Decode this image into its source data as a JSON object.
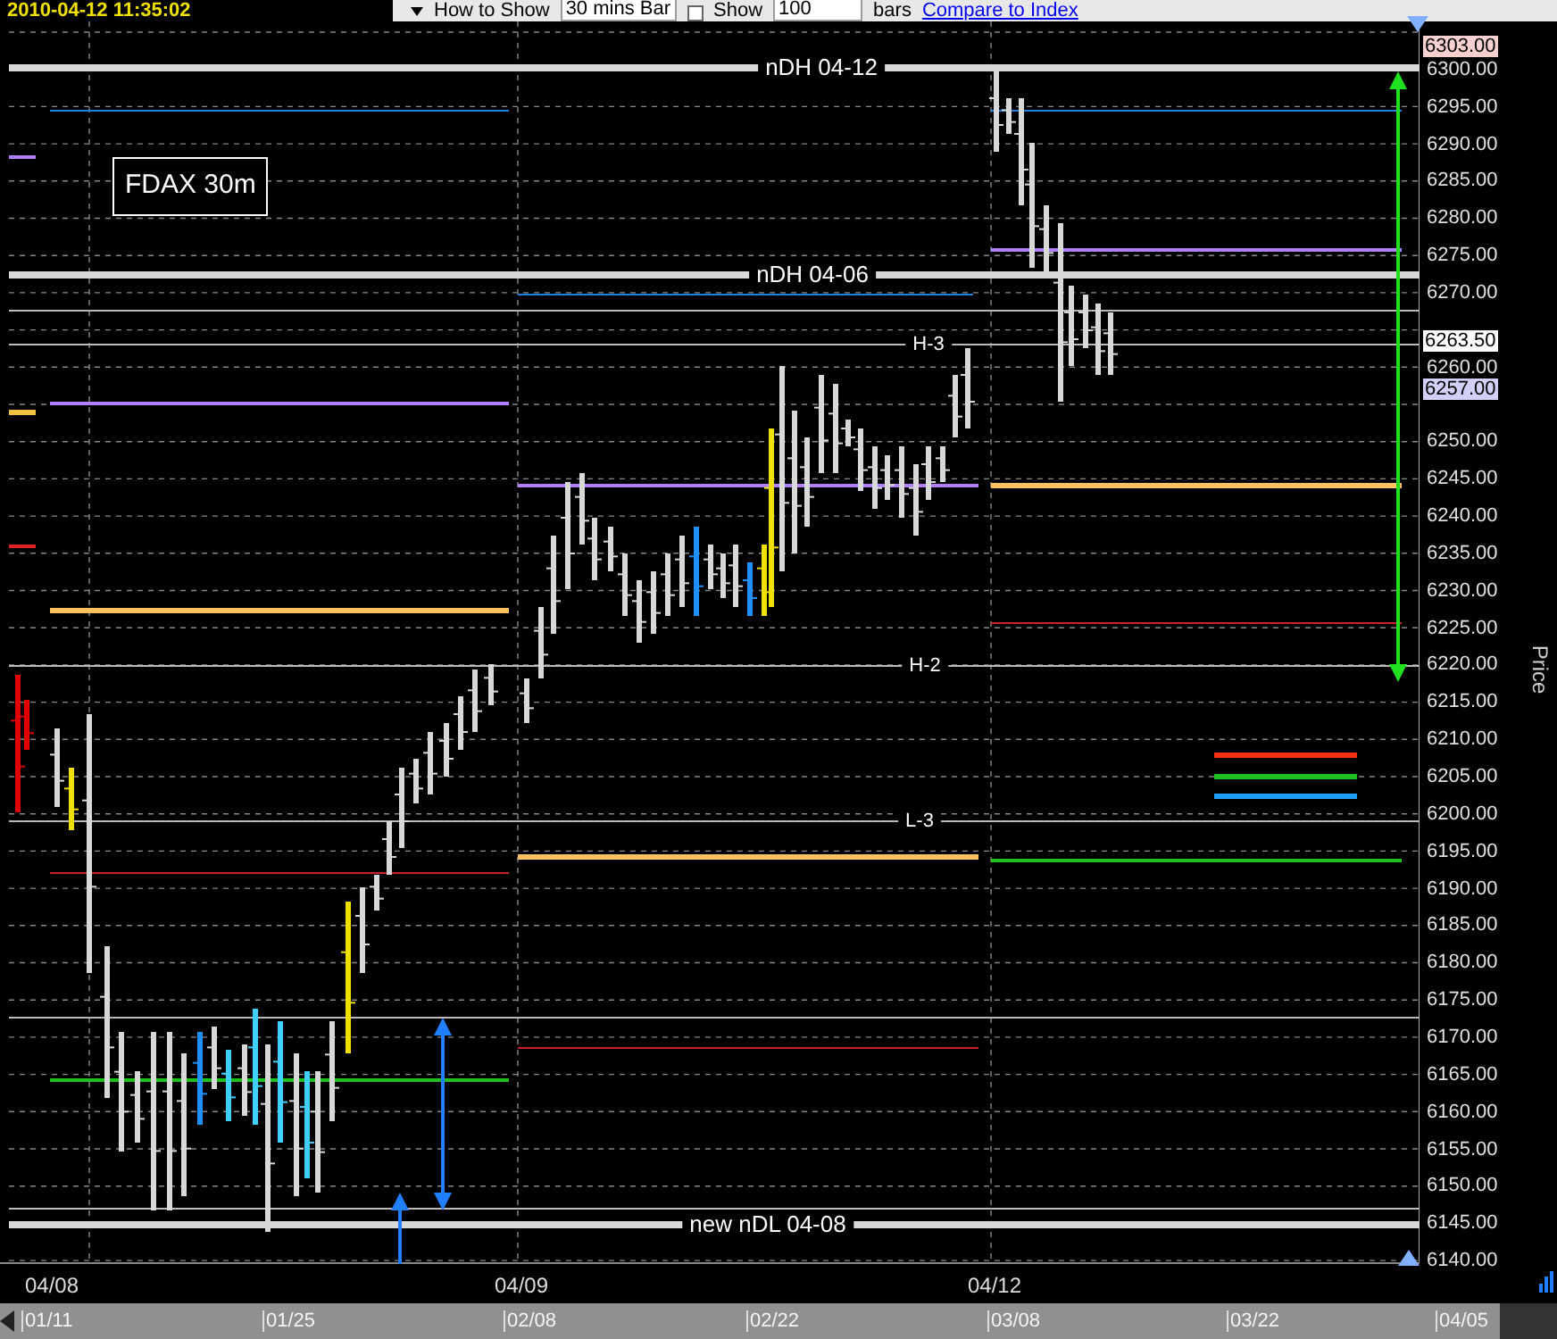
{
  "header": {
    "timestamp": "2010-04-12 11:35:02"
  },
  "toolbar": {
    "how_to_show_label": "How to Show",
    "bar_type": "30 mins Bar",
    "show_checkbox": {
      "label": "Show",
      "checked": false
    },
    "bar_count": "100",
    "bars_label": "bars",
    "compare_link": "Compare to Index"
  },
  "chart": {
    "title": "FDAX 30m",
    "level_labels": [
      {
        "kind": "major",
        "label": "nDH 04-12"
      },
      {
        "kind": "major",
        "label": "nDH 04-06"
      },
      {
        "kind": "pivot",
        "label": "H-3"
      },
      {
        "kind": "pivot",
        "label": "H-2"
      },
      {
        "kind": "pivot",
        "label": "L-3"
      },
      {
        "kind": "major",
        "label": "new nDL 04-08"
      }
    ],
    "y_axis": {
      "title": "Price",
      "ticks": [
        "6300.00",
        "6295.00",
        "6290.00",
        "6285.00",
        "6280.00",
        "6275.00",
        "6270.00",
        "6260.00",
        "6250.00",
        "6245.00",
        "6240.00",
        "6235.00",
        "6230.00",
        "6225.00",
        "6220.00",
        "6215.00",
        "6210.00",
        "6205.00",
        "6200.00",
        "6195.00",
        "6190.00",
        "6185.00",
        "6180.00",
        "6175.00",
        "6170.00",
        "6165.00",
        "6160.00",
        "6155.00",
        "6150.00",
        "6145.00",
        "6140.00"
      ]
    },
    "price_badges": [
      {
        "label": "6303.00",
        "color": "#f8d0d0"
      },
      {
        "label": "6263.50",
        "color": "#ffffff"
      },
      {
        "label": "6257.00",
        "color": "#d0d0f8"
      }
    ],
    "x_axis": {
      "dates": [
        "04/08",
        "04/09",
        "04/12"
      ]
    }
  },
  "scrollbar": {
    "dates": [
      "01/11",
      "01/25",
      "02/08",
      "02/22",
      "03/08",
      "03/22",
      "04/05"
    ]
  }
}
